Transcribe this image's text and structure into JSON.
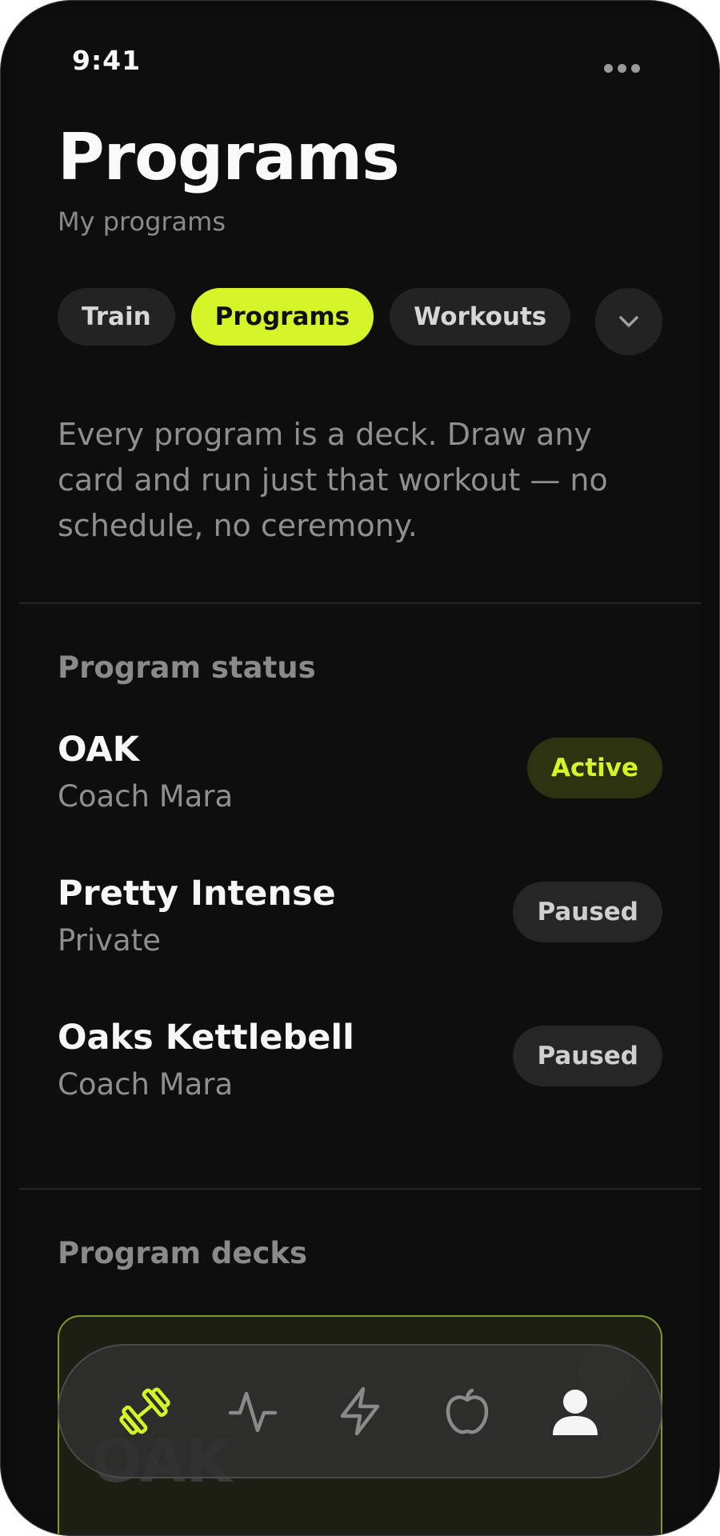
{
  "status_bar": {
    "time": "9:41"
  },
  "header": {
    "title": "Programs",
    "subtitle": "My programs"
  },
  "tabs": [
    {
      "label": "Train",
      "active": false
    },
    {
      "label": "Programs",
      "active": true
    },
    {
      "label": "Workouts",
      "active": false
    }
  ],
  "intro": "Every program is a deck. Draw any card and run just that workout — no schedule, no ceremony.",
  "program_status": {
    "heading": "Program status",
    "items": [
      {
        "name": "OAK",
        "owner": "Coach Mara",
        "status": "Active"
      },
      {
        "name": "Pretty Intense",
        "owner": "Private",
        "status": "Paused"
      },
      {
        "name": "Oaks Kettlebell",
        "owner": "Coach Mara",
        "status": "Paused"
      }
    ]
  },
  "program_decks": {
    "heading": "Program decks",
    "cards": [
      {
        "name": "OAK"
      }
    ]
  },
  "bottom_nav": {
    "items": [
      "dumbbell-icon",
      "activity-icon",
      "lightning-icon",
      "apple-icon",
      "profile-icon"
    ],
    "active_color": "#d6f528",
    "inactive_color": "#8a8a8a"
  },
  "colors": {
    "accent": "#d6f528",
    "background": "#0e0e0e"
  }
}
